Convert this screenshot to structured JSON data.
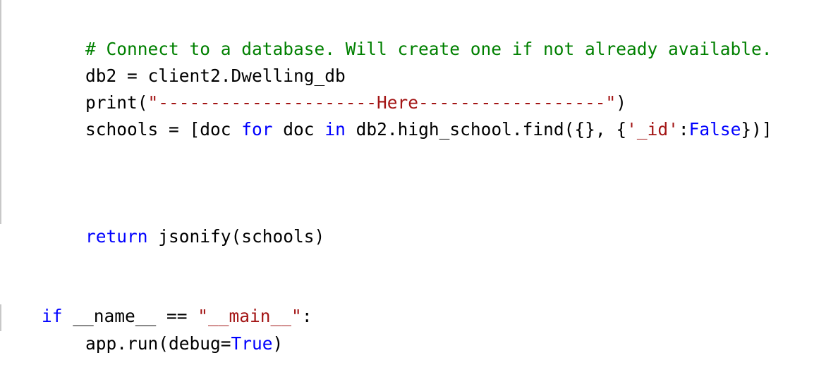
{
  "code": {
    "line1": {
      "text": "# Connect to a database. Will create one if not already available."
    },
    "line2": {
      "text": "db2 = client2.Dwelling_db"
    },
    "line3": {
      "p1": "print(",
      "p2": "\"---------------------Here------------------\"",
      "p3": ")"
    },
    "line4": {
      "p1": "schools = [doc ",
      "p2": "for",
      "p3": " doc ",
      "p4": "in",
      "p5": " db2.high_school.find({}, {",
      "p6": "'_id'",
      "p7": ":",
      "p8": "False",
      "p9": "})]"
    },
    "line5": {
      "p1": "return",
      "p2": " jsonify(schools)"
    },
    "line6": {
      "p1": "if",
      "p2": " __name__ == ",
      "p3": "\"__main__\"",
      "p4": ":"
    },
    "line7": {
      "p1": "app.run(debug=",
      "p2": "True",
      "p3": ")"
    }
  },
  "colors": {
    "comment": "#008000",
    "string": "#a31515",
    "keyword": "#0000ff",
    "text": "#000000",
    "indent_guide": "#c8c8c8"
  }
}
